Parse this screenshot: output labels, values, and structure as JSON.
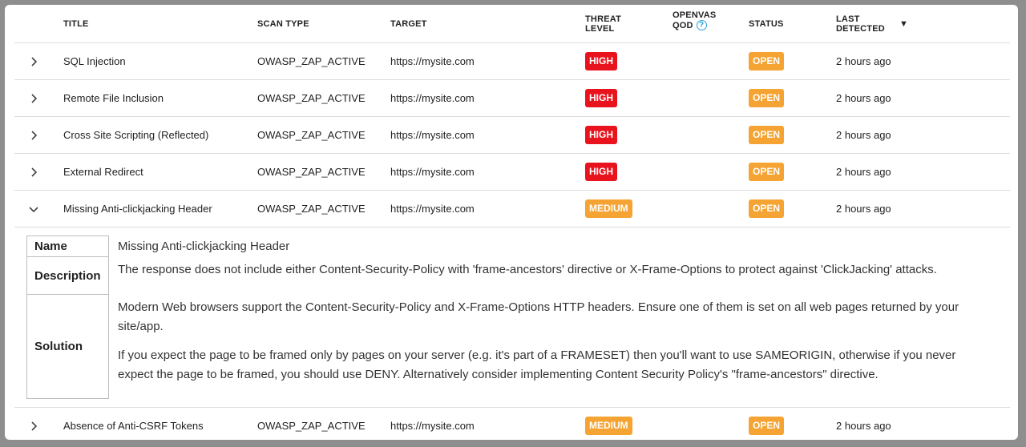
{
  "columns": {
    "title": "TITLE",
    "scan_type": "SCAN TYPE",
    "target": "TARGET",
    "threat_level_1": "THREAT",
    "threat_level_2": "LEVEL",
    "qod_1": "OPENVAS",
    "qod_2": "QOD",
    "status": "STATUS",
    "last_1": "LAST",
    "last_2": "DETECTED",
    "help_glyph": "?",
    "sort_glyph": "▼"
  },
  "rows": [
    {
      "title": "SQL Injection",
      "scan_type": "OWASP_ZAP_ACTIVE",
      "target": "https://mysite.com",
      "threat": "HIGH",
      "status": "OPEN",
      "last": "2 hours ago"
    },
    {
      "title": "Remote File Inclusion",
      "scan_type": "OWASP_ZAP_ACTIVE",
      "target": "https://mysite.com",
      "threat": "HIGH",
      "status": "OPEN",
      "last": "2 hours ago"
    },
    {
      "title": "Cross Site Scripting (Reflected)",
      "scan_type": "OWASP_ZAP_ACTIVE",
      "target": "https://mysite.com",
      "threat": "HIGH",
      "status": "OPEN",
      "last": "2 hours ago"
    },
    {
      "title": "External Redirect",
      "scan_type": "OWASP_ZAP_ACTIVE",
      "target": "https://mysite.com",
      "threat": "HIGH",
      "status": "OPEN",
      "last": "2 hours ago"
    },
    {
      "title": "Missing Anti-clickjacking Header",
      "scan_type": "OWASP_ZAP_ACTIVE",
      "target": "https://mysite.com",
      "threat": "MEDIUM",
      "status": "OPEN",
      "last": "2 hours ago"
    },
    {
      "title": "Absence of Anti-CSRF Tokens",
      "scan_type": "OWASP_ZAP_ACTIVE",
      "target": "https://mysite.com",
      "threat": "MEDIUM",
      "status": "OPEN",
      "last": "2 hours ago"
    }
  ],
  "detail": {
    "name_label": "Name",
    "name_value": "Missing Anti-clickjacking Header",
    "description_label": "Description",
    "description_value": "The response does not include either Content-Security-Policy with 'frame-ancestors' directive or X-Frame-Options to protect against 'ClickJacking' attacks.",
    "solution_label": "Solution",
    "solution_p1": "Modern Web browsers support the Content-Security-Policy and X-Frame-Options HTTP headers. Ensure one of them is set on all web pages returned by your site/app.",
    "solution_p2": "If you expect the page to be framed only by pages on your server (e.g. it's part of a FRAMESET) then you'll want to use SAMEORIGIN, otherwise if you never expect the page to be framed, you should use DENY. Alternatively consider implementing Content Security Policy's \"frame-ancestors\" directive."
  },
  "colors": {
    "high": "#e8131d",
    "medium": "#f5a332",
    "open": "#f5a332",
    "help": "#2a9fd6"
  },
  "icons": {
    "collapsed": "chevron-right-icon",
    "expanded": "chevron-down-icon",
    "help": "help-circle-icon",
    "sort": "sort-desc-icon"
  }
}
